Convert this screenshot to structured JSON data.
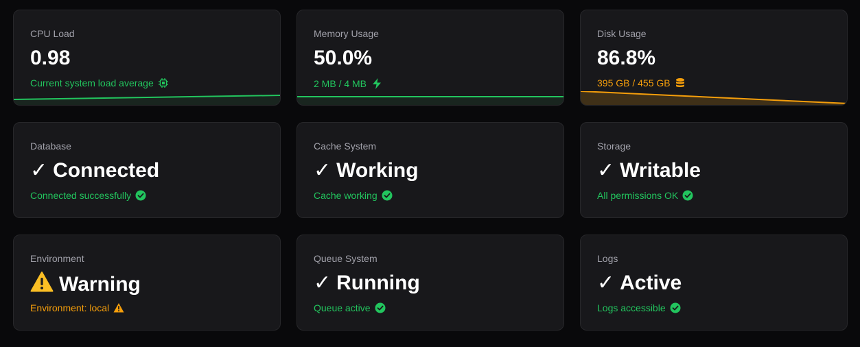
{
  "metrics": {
    "cpu": {
      "label": "CPU Load",
      "value": "0.98",
      "description": "Current system load average",
      "icon": "cpu-chip-icon",
      "color": "#22c55e"
    },
    "memory": {
      "label": "Memory Usage",
      "value": "50.0%",
      "description": "2 MB / 4 MB",
      "icon": "lightning-bolt-icon",
      "color": "#22c55e"
    },
    "disk": {
      "label": "Disk Usage",
      "value": "86.8%",
      "description": "395 GB / 455 GB",
      "icon": "database-stack-icon",
      "color": "#f59e0b"
    }
  },
  "status": {
    "database": {
      "label": "Database",
      "prefix": "✓",
      "value": "Connected",
      "description": "Connected successfully",
      "icon": "check-circle-icon",
      "color": "#22c55e"
    },
    "cache": {
      "label": "Cache System",
      "prefix": "✓",
      "value": "Working",
      "description": "Cache working",
      "icon": "check-circle-icon",
      "color": "#22c55e"
    },
    "storage": {
      "label": "Storage",
      "prefix": "✓",
      "value": "Writable",
      "description": "All permissions OK",
      "icon": "check-circle-icon",
      "color": "#22c55e"
    },
    "environment": {
      "label": "Environment",
      "prefix": "⚠️",
      "value": "Warning",
      "description": "Environment: local",
      "icon": "warning-triangle-icon",
      "color": "#f59e0b"
    },
    "queue": {
      "label": "Queue System",
      "prefix": "✓",
      "value": "Running",
      "description": "Queue active",
      "icon": "check-circle-icon",
      "color": "#22c55e"
    },
    "logs": {
      "label": "Logs",
      "prefix": "✓",
      "value": "Active",
      "description": "Logs accessible",
      "icon": "check-circle-icon",
      "color": "#22c55e"
    }
  }
}
